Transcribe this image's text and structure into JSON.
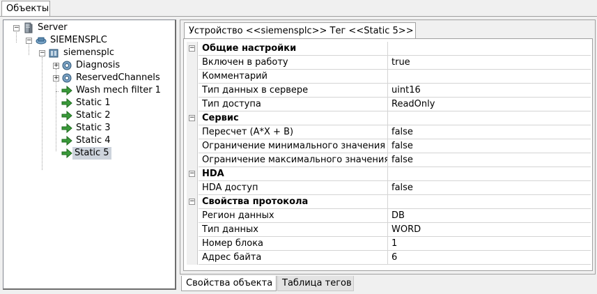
{
  "window": {
    "tab_label": "Объекты"
  },
  "tree": {
    "server": "Server",
    "plc_group": "SIEMENSPLC",
    "device": "siemensplc",
    "items": [
      "Diagnosis",
      "ReservedChannels",
      "Wash mech filter 1",
      "Static 1",
      "Static 2",
      "Static 3",
      "Static 4",
      "Static 5"
    ],
    "selected": "Static 5"
  },
  "properties": {
    "tab_title": "Устройство <<siemensplc>> Тег  <<Static 5>>",
    "rows": [
      {
        "name": "Общие настройки",
        "value": "",
        "category": true
      },
      {
        "name": "Включен в работу",
        "value": "true"
      },
      {
        "name": "Комментарий",
        "value": ""
      },
      {
        "name": "Тип данных в сервере",
        "value": "uint16"
      },
      {
        "name": "Тип доступа",
        "value": "ReadOnly"
      },
      {
        "name": "Сервис",
        "value": "",
        "category": true
      },
      {
        "name": "Пересчет (A*X + B)",
        "value": "false"
      },
      {
        "name": "Ограничение минимального значения",
        "value": "false"
      },
      {
        "name": "Ограничение максимального значения",
        "value": "false"
      },
      {
        "name": "HDA",
        "value": "",
        "category": true
      },
      {
        "name": "HDA доступ",
        "value": "false"
      },
      {
        "name": "Свойства протокола",
        "value": "",
        "category": true
      },
      {
        "name": "Регион данных",
        "value": "DB"
      },
      {
        "name": "Тип данных",
        "value": "WORD"
      },
      {
        "name": "Номер блока",
        "value": "1"
      },
      {
        "name": "Адрес байта",
        "value": "6"
      }
    ]
  },
  "bottom_tabs": {
    "object_props": "Свойства объекта",
    "tag_table": "Таблица тегов"
  }
}
